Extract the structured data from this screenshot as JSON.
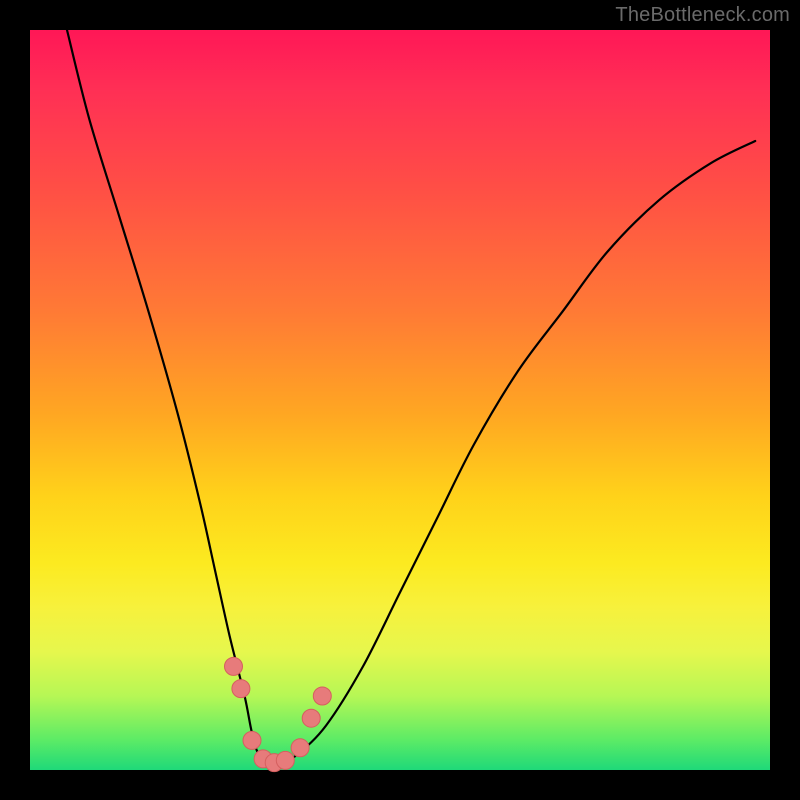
{
  "watermark": "TheBottleneck.com",
  "colors": {
    "frame": "#000000",
    "gradient_top": "#ff1756",
    "gradient_mid": "#ffd21a",
    "gradient_bottom": "#1fd979",
    "curve": "#000000",
    "marker_fill": "#e77b7b",
    "marker_stroke": "#d55f5f"
  },
  "chart_data": {
    "type": "line",
    "title": "",
    "xlabel": "",
    "ylabel": "",
    "xlim": [
      0,
      100
    ],
    "ylim": [
      0,
      100
    ],
    "grid": false,
    "legend": false,
    "series": [
      {
        "name": "bottleneck-curve",
        "x": [
          5,
          8,
          12,
          16,
          20,
          23,
          25,
          27,
          29,
          30,
          31,
          33,
          34,
          36,
          40,
          45,
          50,
          55,
          60,
          66,
          72,
          78,
          85,
          92,
          98
        ],
        "values": [
          100,
          88,
          75,
          62,
          48,
          36,
          27,
          18,
          10,
          5,
          2,
          1,
          1,
          2,
          6,
          14,
          24,
          34,
          44,
          54,
          62,
          70,
          77,
          82,
          85
        ]
      }
    ],
    "markers": {
      "name": "highlighted-points",
      "x": [
        27.5,
        28.5,
        30,
        31.5,
        33,
        34.5,
        36.5,
        38,
        39.5
      ],
      "values": [
        14,
        11,
        4,
        1.5,
        1,
        1.3,
        3,
        7,
        10
      ]
    }
  }
}
